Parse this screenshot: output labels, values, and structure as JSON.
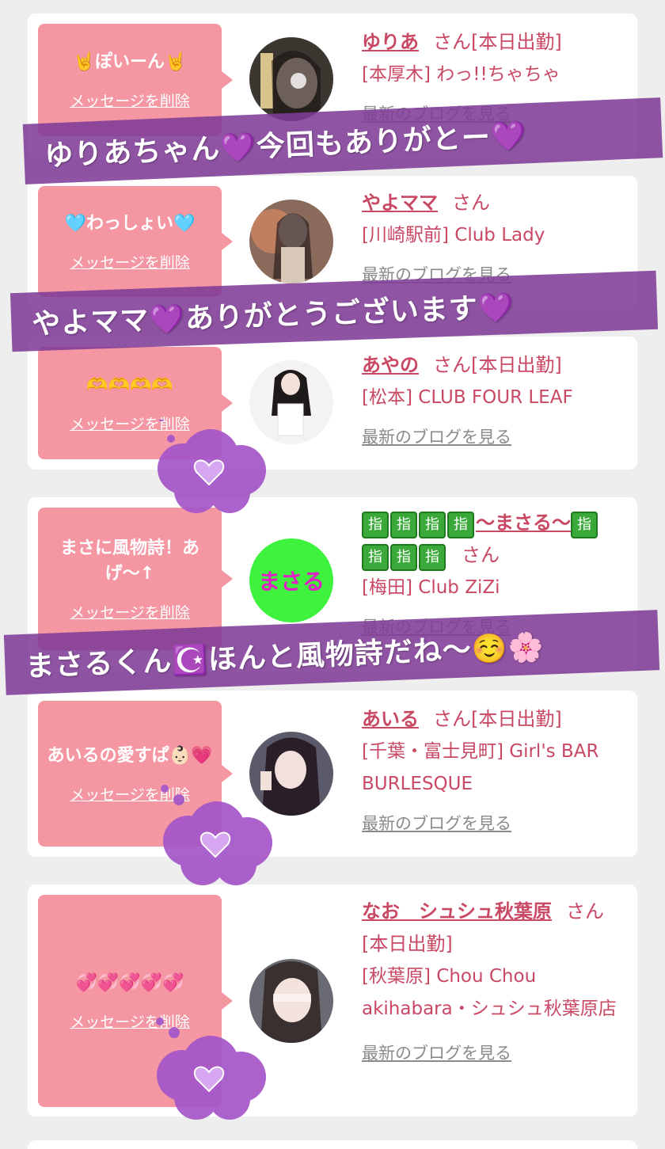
{
  "common": {
    "delete_label": "メッセージを削除",
    "blog_label": "最新のブログを見る",
    "san": "さん"
  },
  "cards": [
    {
      "message": "🤘ぽいーん🤘",
      "name": "ゆりあ",
      "status": "[本日出勤]",
      "shop": "[本厚木] わっ!!ちゃちゃ"
    },
    {
      "message": "🩵わっしょい🩵",
      "name": "やよママ",
      "status": "",
      "shop": "[川崎駅前] Club Lady"
    },
    {
      "message": "🫶🫶🫶🫶",
      "name": "あやの",
      "status": "[本日出勤]",
      "shop": "[松本] CLUB FOUR LEAF"
    },
    {
      "message": "まさに風物詩！あげ〜↑",
      "name_prefix": "指指指指",
      "name": "〜まさる〜",
      "name_suffix": "指指指指",
      "status": "",
      "shop": "[梅田] Club ZiZi",
      "avatar_text": "まさる"
    },
    {
      "message": "あいるの愛すぱ👶🏻💗",
      "name": "あいる",
      "status": "[本日出勤]",
      "shop": "[千葉・富士見町] Girl's BAR BURLESQUE"
    },
    {
      "message": "💞💞💞💞💞",
      "name": "なお　シュシュ秋葉原",
      "status": "[本日出勤]",
      "shop": "[秋葉原] Chou Chou akihabara・シュシュ秋葉原店"
    }
  ],
  "banners": [
    "ゆりあちゃん💜今回もありがとー💜",
    "やよママ💜ありがとうございます💜",
    "まさるくん☪️ほんと風物詩だね〜☺️🌸"
  ],
  "colors": {
    "bubble": "#f497a3",
    "name": "#c94864",
    "banner": "#803c96",
    "cloud": "#a455c8"
  }
}
